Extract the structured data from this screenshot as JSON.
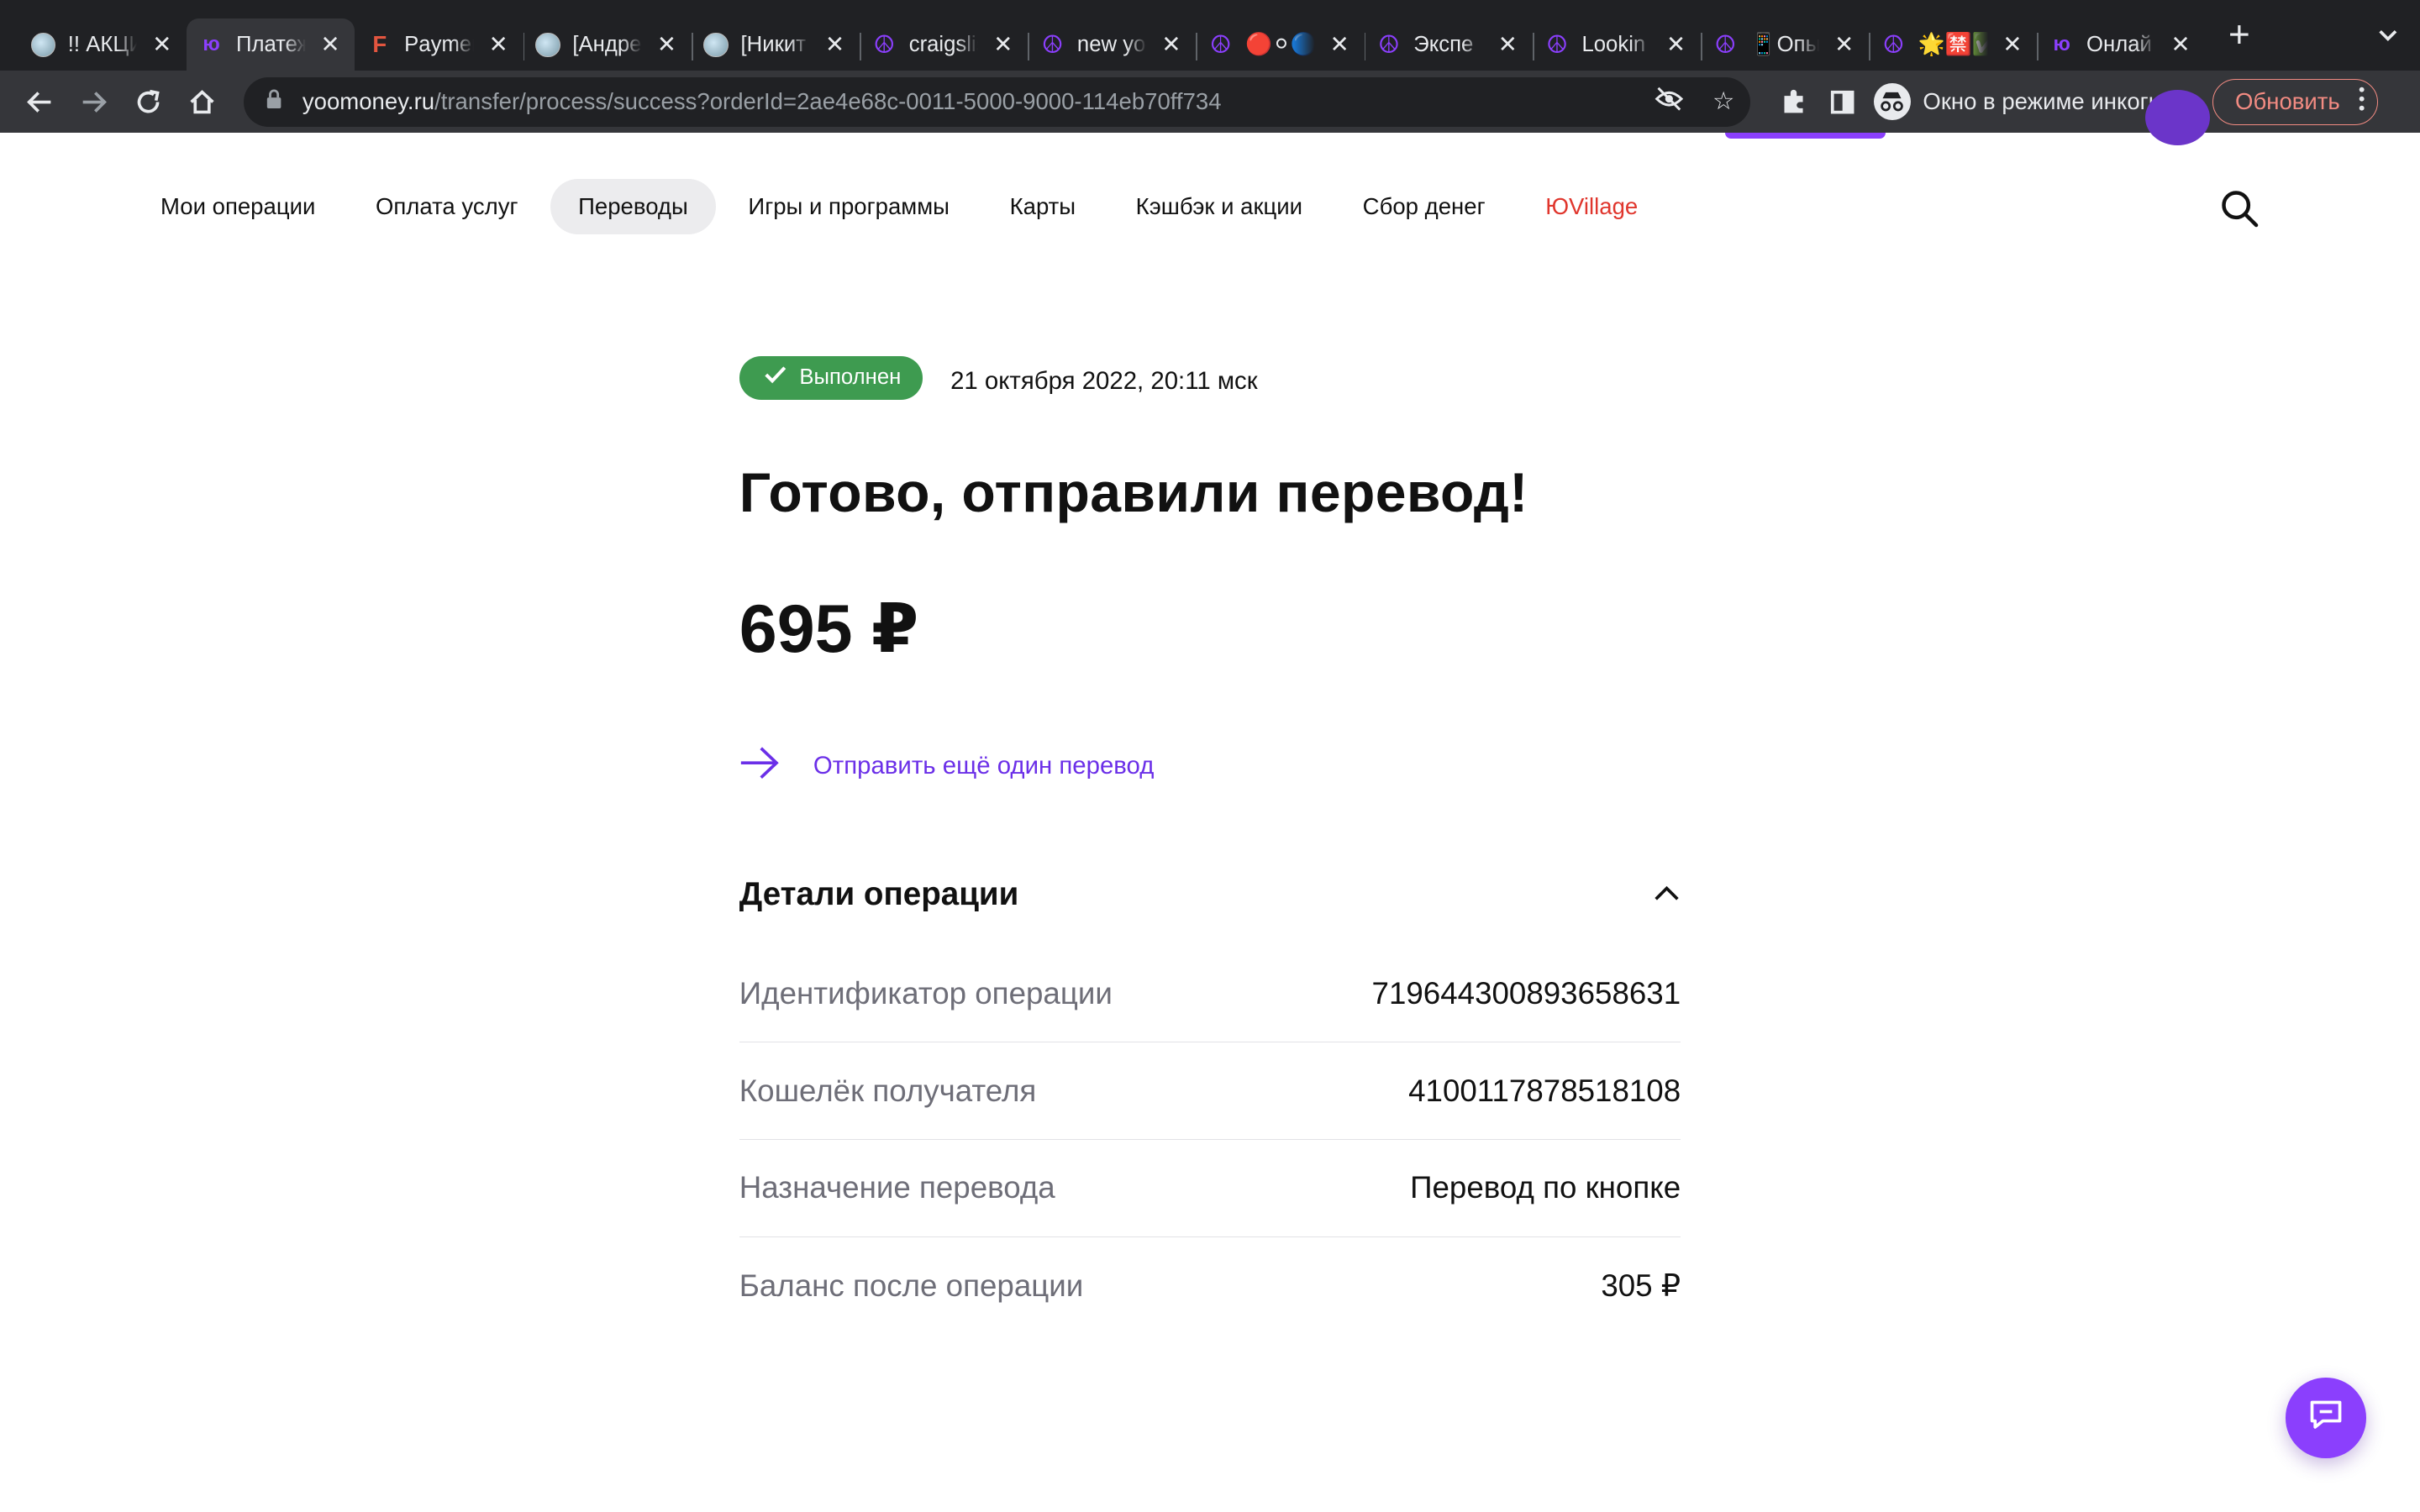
{
  "browser": {
    "tabs": [
      {
        "title": "!! АКЦИ",
        "favicon": "globe-icon",
        "active": false
      },
      {
        "title": "Платеж",
        "favicon": "yoomoney-icon",
        "active": true
      },
      {
        "title": "Payment",
        "favicon": "f-letter-icon",
        "active": false
      },
      {
        "title": "[Андрей",
        "favicon": "globe-icon",
        "active": false
      },
      {
        "title": "[Никит",
        "favicon": "globe-icon",
        "active": false
      },
      {
        "title": "craigslist",
        "favicon": "peace-icon",
        "active": false
      },
      {
        "title": "new york",
        "favicon": "peace-icon",
        "active": false
      },
      {
        "title": "🔴⚪🔵",
        "favicon": "peace-icon",
        "active": false
      },
      {
        "title": "Экспе",
        "favicon": "peace-icon",
        "active": false
      },
      {
        "title": "Lookin",
        "favicon": "peace-icon",
        "active": false
      },
      {
        "title": "📱Опы",
        "favicon": "peace-icon",
        "active": false
      },
      {
        "title": "🌟🈲✅",
        "favicon": "peace-icon",
        "active": false
      },
      {
        "title": "Онлай",
        "favicon": "yoomoney-icon",
        "active": false
      }
    ],
    "url_host": "yoomoney.ru",
    "url_path": "/transfer/process/success?orderId=2ae4e68c-0011-5000-9000-114eb70ff734",
    "incognito_label": "Окно в режиме инкогнито",
    "update_label": "Обновить"
  },
  "nav": {
    "items": [
      {
        "label": "Мои операции",
        "active": false
      },
      {
        "label": "Оплата услуг",
        "active": false
      },
      {
        "label": "Переводы",
        "active": true
      },
      {
        "label": "Игры и программы",
        "active": false
      },
      {
        "label": "Карты",
        "active": false
      },
      {
        "label": "Кэшбэк и акции",
        "active": false
      },
      {
        "label": "Сбор денег",
        "active": false
      },
      {
        "label": "ЮVillage",
        "active": false
      }
    ]
  },
  "status": {
    "badge": "Выполнен",
    "date": "21 октября 2022, 20:11 мск"
  },
  "title": "Готово, отправили перевод!",
  "amount": "695 ₽",
  "send_again": "Отправить ещё один перевод",
  "details": {
    "title": "Детали операции",
    "rows": [
      {
        "label": "Идентификатор операции",
        "value": "719644300893658631"
      },
      {
        "label": "Кошелёк получателя",
        "value": "4100117878518108"
      },
      {
        "label": "Назначение перевода",
        "value": "Перевод по кнопке"
      },
      {
        "label": "Баланс после операции",
        "value": "305 ₽"
      }
    ]
  },
  "colors": {
    "accent": "#8b3ffd",
    "link": "#6b2fe8",
    "success": "#3e9b50",
    "village": "#e0362d"
  }
}
